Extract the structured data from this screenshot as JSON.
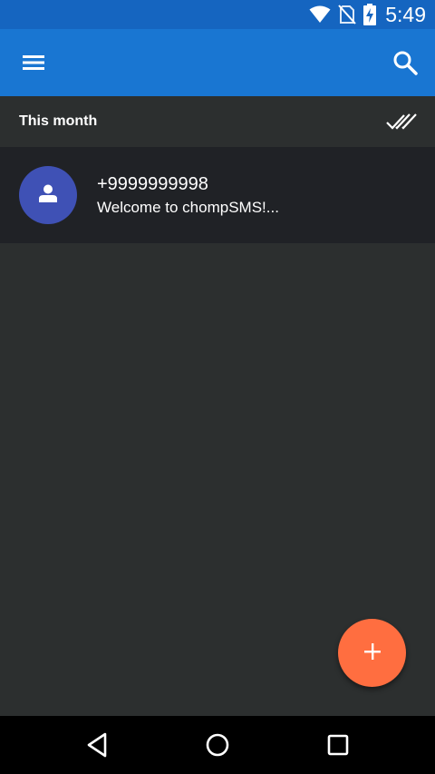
{
  "status_bar": {
    "time": "5:49",
    "icons": [
      "wifi-icon",
      "no-sim-icon",
      "battery-charging-icon"
    ]
  },
  "app_bar": {
    "menu_icon": "menu-icon",
    "search_icon": "search-icon"
  },
  "section": {
    "title": "This month",
    "action_icon": "mark-all-read-icon"
  },
  "conversations": [
    {
      "name": "+9999999998",
      "snippet": "Welcome to chompSMS!...",
      "avatar_icon": "person-icon"
    }
  ],
  "fab": {
    "icon": "add-icon"
  },
  "nav_bar": {
    "icons": [
      "back-icon",
      "home-icon",
      "recents-icon"
    ]
  },
  "colors": {
    "status_bar": "#1565c0",
    "app_bar": "#1976d2",
    "background": "#2c2f2f",
    "conversation_row": "#202226",
    "avatar": "#3f51b5",
    "fab": "#ff6e40",
    "nav_bar": "#000000"
  }
}
